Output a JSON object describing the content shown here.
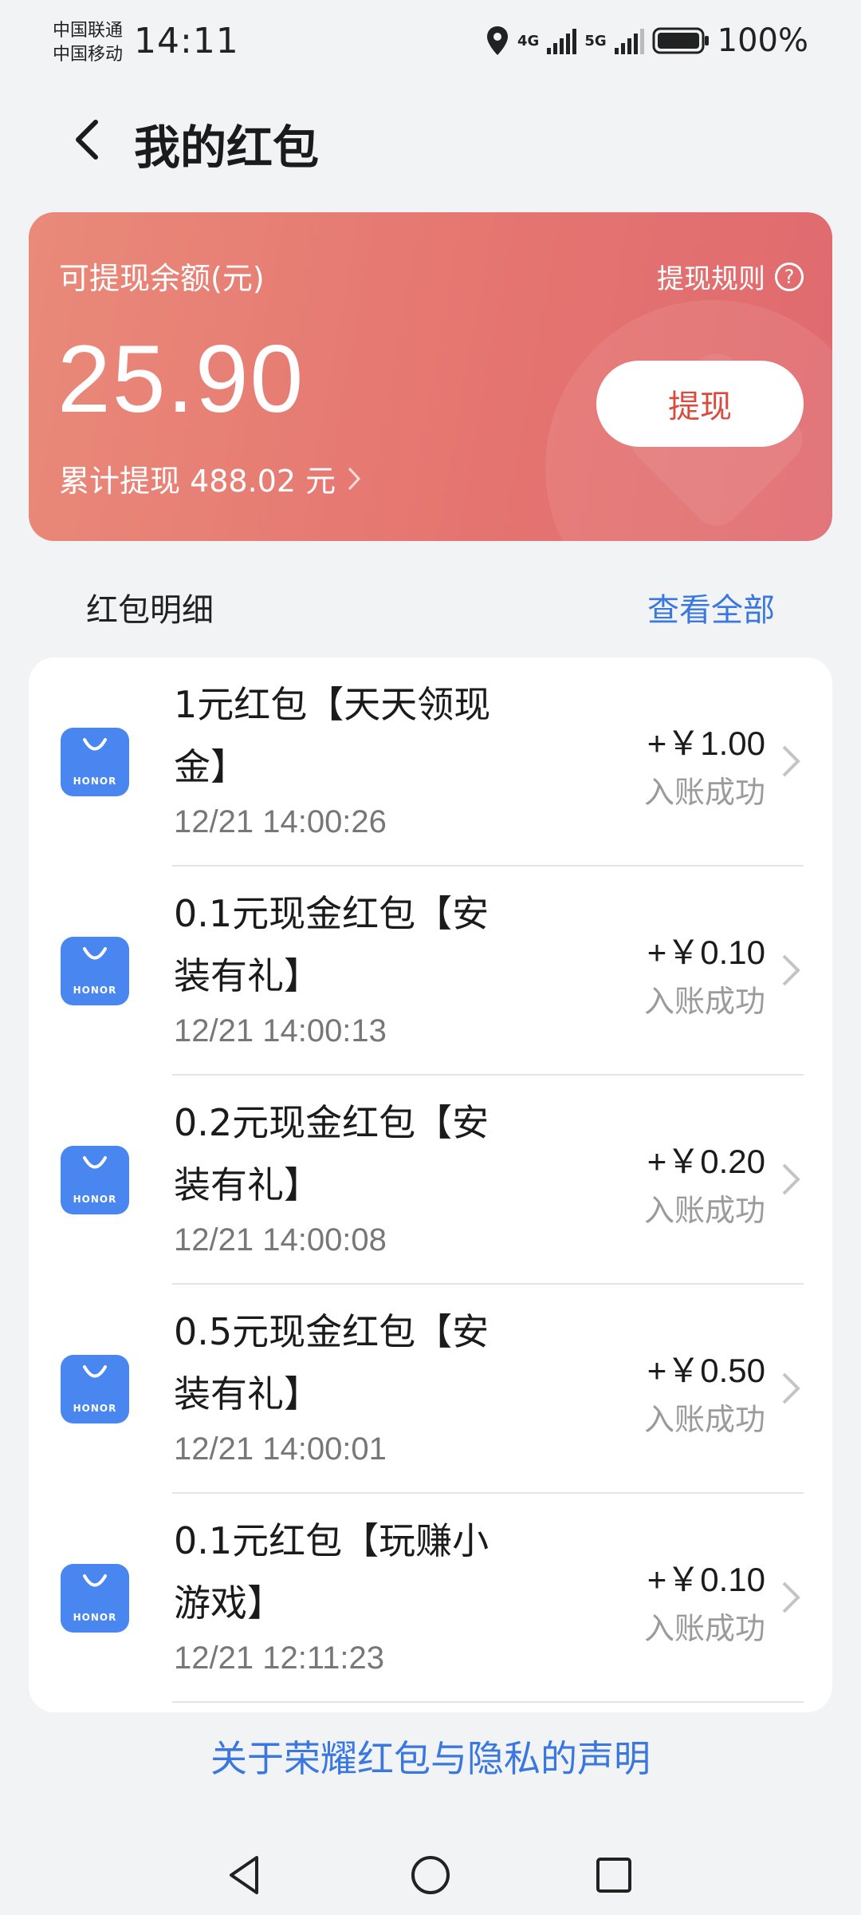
{
  "status_bar": {
    "carrier_1": "中国联通",
    "carrier_2": "中国移动",
    "time": "14:11",
    "net_1": "4G",
    "net_2": "5G",
    "battery": "100%"
  },
  "header": {
    "title": "我的红包"
  },
  "balance_card": {
    "label": "可提现余额(元)",
    "rules_label": "提现规则",
    "amount": "25.90",
    "withdraw_label": "提现",
    "total_withdrawn": "累计提现 488.02 元"
  },
  "detail_section": {
    "title": "红包明细",
    "view_all": "查看全部"
  },
  "app_icon_text": "HONOR",
  "items": [
    {
      "title": "1元红包【天天领现金】",
      "time": "12/21 14:00:26",
      "amount": "+￥1.00",
      "status": "入账成功"
    },
    {
      "title": "0.1元现金红包【安装有礼】",
      "time": "12/21 14:00:13",
      "amount": "+￥0.10",
      "status": "入账成功"
    },
    {
      "title": "0.2元现金红包【安装有礼】",
      "time": "12/21 14:00:08",
      "amount": "+￥0.20",
      "status": "入账成功"
    },
    {
      "title": "0.5元现金红包【安装有礼】",
      "time": "12/21 14:00:01",
      "amount": "+￥0.50",
      "status": "入账成功"
    },
    {
      "title": "0.1元红包【玩赚小游戏】",
      "time": "12/21 12:11:23",
      "amount": "+￥0.10",
      "status": "入账成功"
    }
  ],
  "footer": {
    "privacy_link": "关于荣耀红包与隐私的声明"
  },
  "colors": {
    "card": "#e57570",
    "link": "#3a78e0",
    "withdraw_text": "#d94b3e",
    "app_icon": "#4a86f0"
  }
}
